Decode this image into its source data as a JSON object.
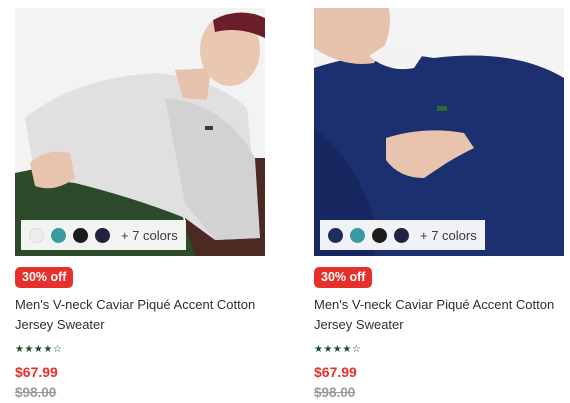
{
  "products": [
    {
      "swatch_colors": [
        "#eeeeee",
        "#3a9aa2",
        "#1c1c1c",
        "#1f2540"
      ],
      "more_colors": "+ 7 colors",
      "badge": "30% off",
      "title": "Men's V-neck Caviar Piqué Accent Cotton Jersey Sweater",
      "rating": "★★★★☆",
      "price": "$67.99",
      "original_price": "$98.00"
    },
    {
      "swatch_colors": [
        "#1d2f58",
        "#3a9aa2",
        "#1c1c1c",
        "#1f2540"
      ],
      "more_colors": "+ 7 colors",
      "badge": "30% off",
      "title": "Men's V-neck Caviar Piqué Accent Cotton Jersey Sweater",
      "rating": "★★★★☆",
      "price": "$67.99",
      "original_price": "$98.00"
    }
  ]
}
